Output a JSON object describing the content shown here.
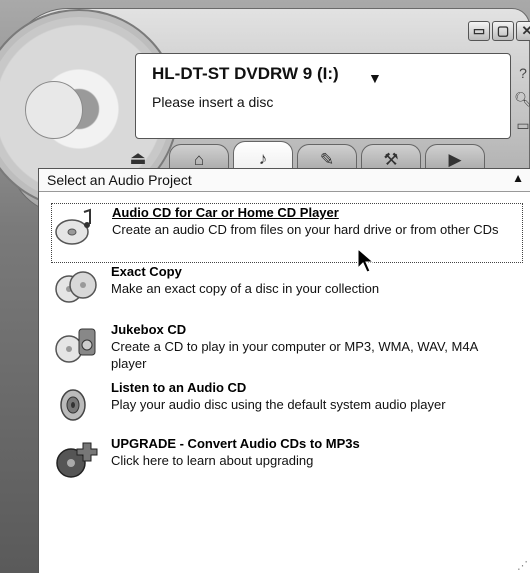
{
  "window": {
    "drive_name": "HL-DT-ST DVDRW 9 (I:)",
    "status": "Please insert a disc",
    "minimize": "▭",
    "restore": "▢",
    "close": "✕"
  },
  "side_icons": [
    "help-icon",
    "search-icon",
    "folder-icon"
  ],
  "tabs": [
    {
      "name": "home-tab",
      "glyph": "⌂"
    },
    {
      "name": "audio-tab",
      "glyph": "♪"
    },
    {
      "name": "data-tab",
      "glyph": "✎"
    },
    {
      "name": "tools-tab",
      "glyph": "⚒"
    },
    {
      "name": "video-tab",
      "glyph": "▶"
    }
  ],
  "panel": {
    "title": "Select an Audio Project",
    "items": [
      {
        "title": "Audio CD for Car or Home CD Player",
        "desc": "Create an audio CD from files on your hard drive or from other CDs",
        "icon": "audio-cd-icon"
      },
      {
        "title": "Exact Copy",
        "desc": "Make an exact copy of a disc in your collection",
        "icon": "copy-disc-icon"
      },
      {
        "title": "Jukebox CD",
        "desc": "Create a CD to play in your computer or MP3, WMA, WAV, M4A player",
        "icon": "jukebox-cd-icon"
      },
      {
        "title": "Listen to an Audio CD",
        "desc": "Play your audio disc using the default system audio player",
        "icon": "speaker-icon"
      },
      {
        "title": "UPGRADE - Convert Audio CDs to MP3s",
        "desc": "Click here to learn about upgrading",
        "icon": "upgrade-icon"
      }
    ]
  }
}
